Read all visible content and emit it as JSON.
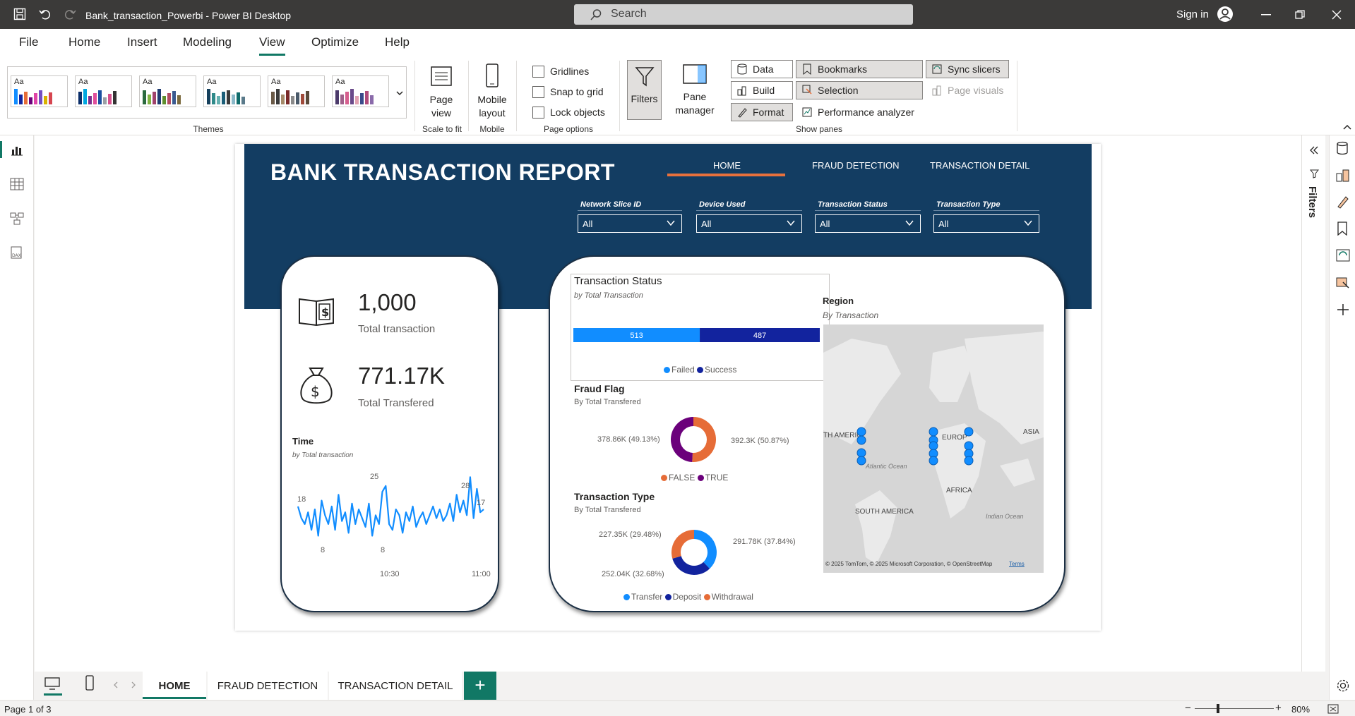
{
  "window": {
    "title": "Bank_transaction_Powerbi - Power BI Desktop",
    "search_placeholder": "Search",
    "sign_in": "Sign in"
  },
  "menu": [
    "File",
    "Home",
    "Insert",
    "Modeling",
    "View",
    "Optimize",
    "Help"
  ],
  "menu_active": "View",
  "ribbon": {
    "themes_label": "Themes",
    "page_view": "Page view",
    "scale_to_fit": "Scale to fit",
    "mobile_layout": "Mobile layout",
    "mobile_label": "Mobile",
    "gridlines": "Gridlines",
    "snap_to_grid": "Snap to grid",
    "lock_objects": "Lock objects",
    "page_options": "Page options",
    "filters": "Filters",
    "pane_manager": "Pane manager",
    "data": "Data",
    "build": "Build",
    "format": "Format",
    "bookmarks": "Bookmarks",
    "selection": "Selection",
    "performance_analyzer": "Performance analyzer",
    "sync_slicers": "Sync slicers",
    "page_visuals": "Page visuals",
    "show_panes": "Show panes",
    "theme_aa": "Aa"
  },
  "right_panel": {
    "filters": "Filters"
  },
  "report": {
    "title": "BANK TRANSACTION REPORT",
    "nav": [
      "HOME",
      "FRAUD DETECTION",
      "TRANSACTION DETAIL"
    ],
    "slicers": [
      {
        "label": "Network Slice ID",
        "value": "All"
      },
      {
        "label": "Device Used",
        "value": "All"
      },
      {
        "label": "Transaction Status",
        "value": "All"
      },
      {
        "label": "Transaction Type",
        "value": "All"
      }
    ],
    "kpis": [
      {
        "value": "1,000",
        "label": "Total transaction"
      },
      {
        "value": "771.17K",
        "label": "Total Transfered"
      }
    ],
    "time_chart": {
      "title": "Time",
      "subtitle": "by Total transaction",
      "x_labels": [
        "10:30",
        "11:00"
      ],
      "point_labels": [
        "18",
        "25",
        "8",
        "8",
        "28",
        "17"
      ]
    },
    "status_chart": {
      "title": "Transaction Status",
      "subtitle": "by Total Transaction",
      "legend": [
        "Failed",
        "Success"
      ]
    },
    "fraud_chart": {
      "title": "Fraud Flag",
      "subtitle": "By Total Transfered",
      "legend": [
        "FALSE",
        "TRUE"
      ]
    },
    "type_chart": {
      "title": "Transaction Type",
      "subtitle": "By Total Transfered",
      "legend": [
        "Transfer",
        "Deposit",
        "Withdrawal"
      ]
    },
    "map": {
      "title": "Region",
      "subtitle": "By Transaction",
      "labels": [
        "TH AMERIC",
        "EUROP",
        "ASIA",
        "Atlantic Ocean",
        "AFRICA",
        "SOUTH AMERICA",
        "Indian Ocean"
      ],
      "attribution": "© 2025 TomTom, © 2025 Microsoft Corporation, © OpenStreetMap",
      "terms": "Terms"
    }
  },
  "chart_data": [
    {
      "type": "bar",
      "title": "Transaction Status",
      "categories": [
        "Failed",
        "Success"
      ],
      "values": [
        513,
        487
      ],
      "colors": [
        "#118dff",
        "#12239e"
      ]
    },
    {
      "type": "pie",
      "title": "Fraud Flag",
      "categories": [
        "FALSE",
        "TRUE"
      ],
      "values": [
        392.3,
        378.86
      ],
      "value_labels": [
        "392.3K (50.87%)",
        "378.86K (49.13%)"
      ],
      "colors": [
        "#e66c37",
        "#6b007b"
      ]
    },
    {
      "type": "pie",
      "title": "Transaction Type",
      "categories": [
        "Transfer",
        "Deposit",
        "Withdrawal"
      ],
      "values": [
        291.78,
        252.04,
        227.35
      ],
      "value_labels": [
        "291.78K (37.84%)",
        "252.04K (32.68%)",
        "227.35K (29.48%)"
      ],
      "colors": [
        "#118dff",
        "#12239e",
        "#e66c37"
      ]
    },
    {
      "type": "line",
      "title": "Time",
      "values": [
        18,
        14,
        12,
        16,
        10,
        17,
        8,
        20,
        15,
        12,
        18,
        10,
        22,
        13,
        16,
        9,
        19,
        12,
        17,
        14,
        11,
        19,
        8,
        15,
        12,
        23,
        25,
        12,
        10,
        17,
        15,
        9,
        16,
        13,
        18,
        11,
        14,
        16,
        12,
        15,
        18,
        14,
        17,
        13,
        15,
        19,
        13,
        22,
        16,
        20,
        15,
        28,
        14,
        24,
        16,
        17
      ],
      "color": "#118dff"
    }
  ],
  "pages": [
    "HOME",
    "FRAUD DETECTION",
    "TRANSACTION DETAIL"
  ],
  "status": {
    "page": "Page 1 of 3",
    "zoom": "80%"
  },
  "colors": {
    "header": "#133d62",
    "accent": "#e8713c",
    "brand": "#117865"
  }
}
